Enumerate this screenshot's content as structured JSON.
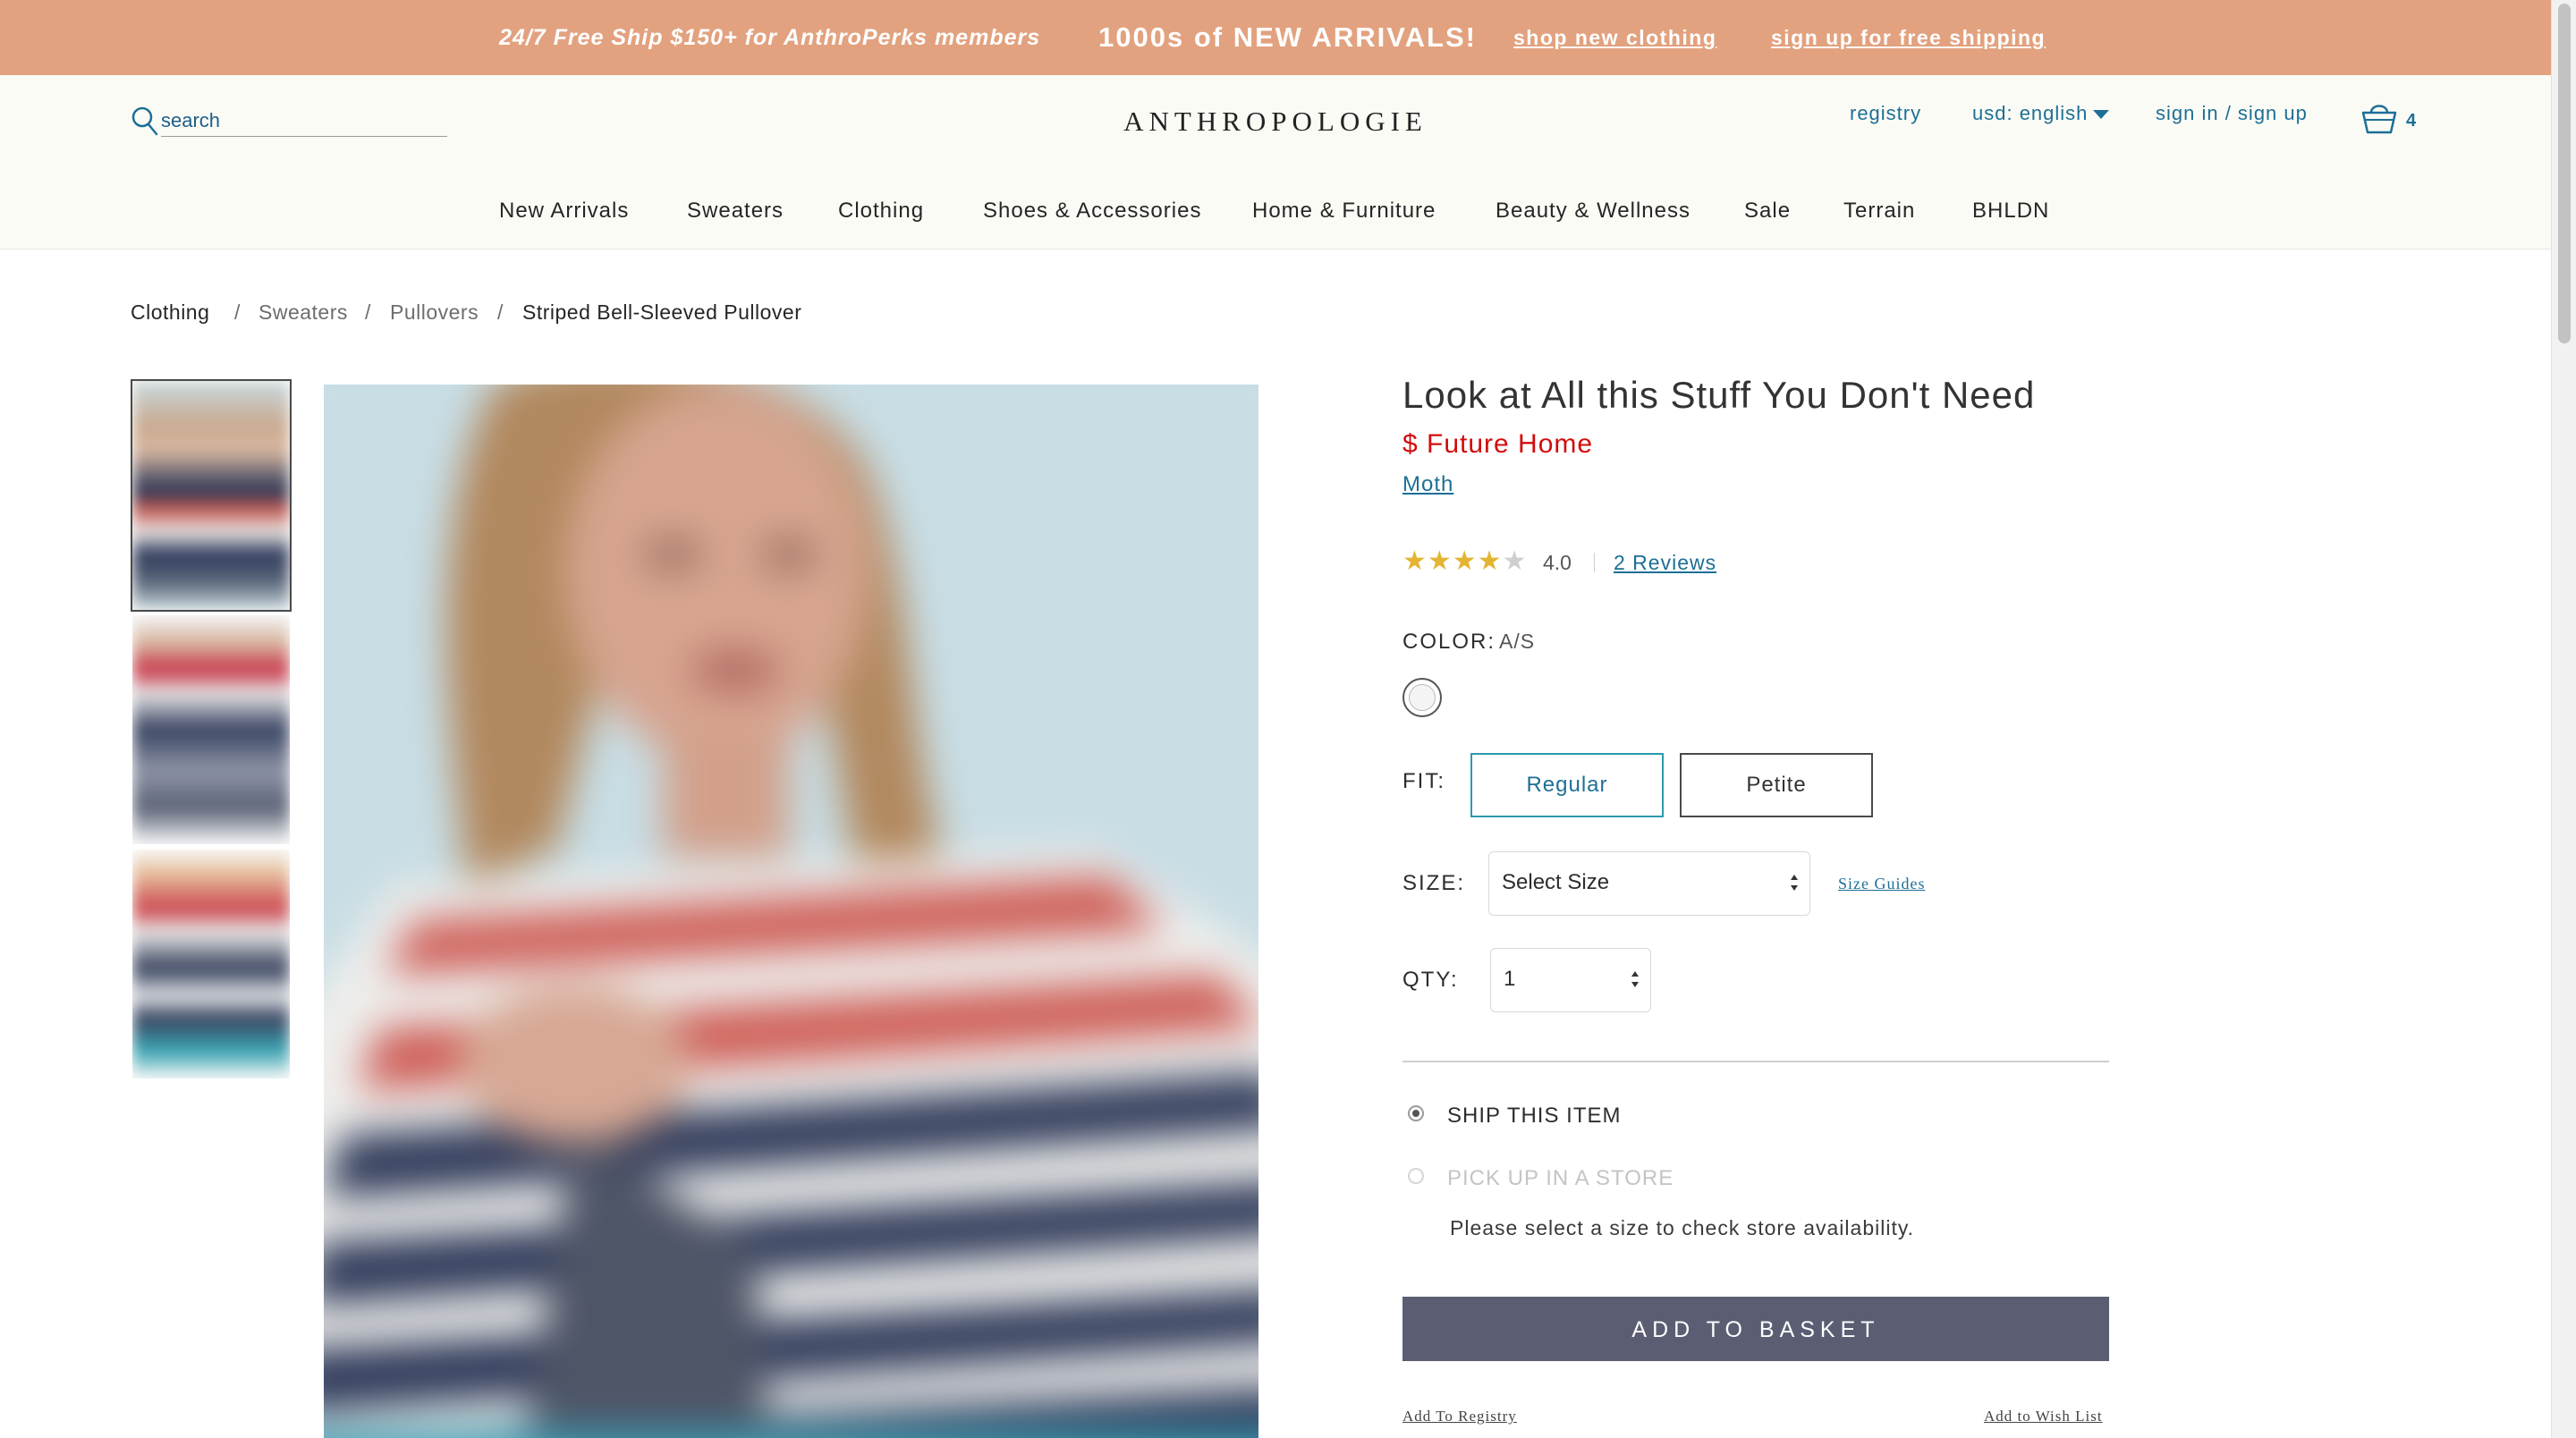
{
  "promo": {
    "text1": "24/7 Free Ship $150+ for AnthroPerks members",
    "text2": "1000s of NEW ARRIVALS!",
    "link1": "shop new clothing",
    "link2": "sign up for free shipping",
    "background": "#e2a27f"
  },
  "header": {
    "search_placeholder": "search",
    "logo": "ANTHROPOLOGIE",
    "registry": "registry",
    "currency": "usd: english",
    "signin": "sign in / sign up",
    "basket_count": "4"
  },
  "nav": {
    "items": [
      "New Arrivals",
      "Sweaters",
      "Clothing",
      "Shoes & Accessories",
      "Home & Furniture",
      "Beauty & Wellness",
      "Sale",
      "Terrain",
      "BHLDN"
    ]
  },
  "breadcrumb": {
    "items": [
      "Clothing",
      "Sweaters",
      "Pullovers",
      "Striped Bell-Sleeved Pullover"
    ],
    "separator": "/"
  },
  "product": {
    "title": "Look at All this Stuff You Don't Need",
    "price": "$ Future Home",
    "brand": "Moth",
    "rating_value": 4.0,
    "rating_text": "4.0",
    "rating_max": 5,
    "reviews_link": "2 Reviews",
    "color_label": "COLOR:",
    "color_value": "A/S",
    "fit_label": "FIT:",
    "fit_options": [
      "Regular",
      "Petite"
    ],
    "fit_selected": "Regular",
    "size_label": "SIZE:",
    "size_select": "Select Size",
    "size_guides": "Size Guides",
    "qty_label": "QTY:",
    "qty_value": "1",
    "ship_option": "SHIP THIS ITEM",
    "pickup_option": "PICK UP IN A STORE",
    "store_message": "Please select a size to check store availability.",
    "add_to_basket": "ADD TO BASKET",
    "add_to_registry": "Add To Registry",
    "add_to_wishlist": "Add to Wish List"
  },
  "colors": {
    "accent": "#1d6f96",
    "price_red": "#d20c0c",
    "button_dark": "#5b5e73",
    "star_gold": "#e3b533"
  }
}
